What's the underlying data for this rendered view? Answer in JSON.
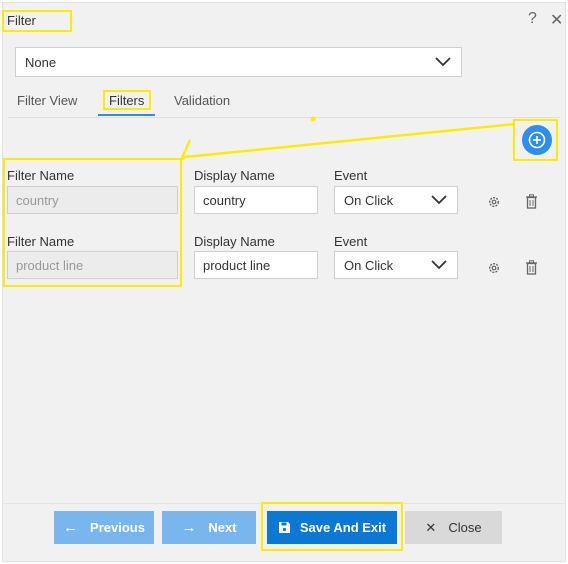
{
  "dialog": {
    "title": "Filter",
    "help_icon": "question-mark-icon",
    "close_icon": "close-icon"
  },
  "selector": {
    "value": "None",
    "icon": "chevron-down-icon"
  },
  "tabs": [
    {
      "label": "Filter View"
    },
    {
      "label": "Filters"
    },
    {
      "label": "Validation"
    }
  ],
  "add_button_icon": "plus-circle-icon",
  "filters": [
    {
      "filter_name_label": "Filter Name",
      "filter_name_value": "country",
      "display_name_label": "Display Name",
      "display_name_value": "country",
      "event_label": "Event",
      "event_value": "On Click"
    },
    {
      "filter_name_label": "Filter Name",
      "filter_name_value": "product line",
      "display_name_label": "Display Name",
      "display_name_value": "product line",
      "event_label": "Event",
      "event_value": "On Click"
    }
  ],
  "footer": {
    "previous": "Previous",
    "next": "Next",
    "save": "Save And Exit",
    "close": "Close"
  },
  "colors": {
    "highlight": "#ffeb00",
    "accent": "#2d8ef0",
    "primary_button": "#0b78d4",
    "disabled_button": "#7ab6ee",
    "close_button": "#d9d9d9"
  }
}
